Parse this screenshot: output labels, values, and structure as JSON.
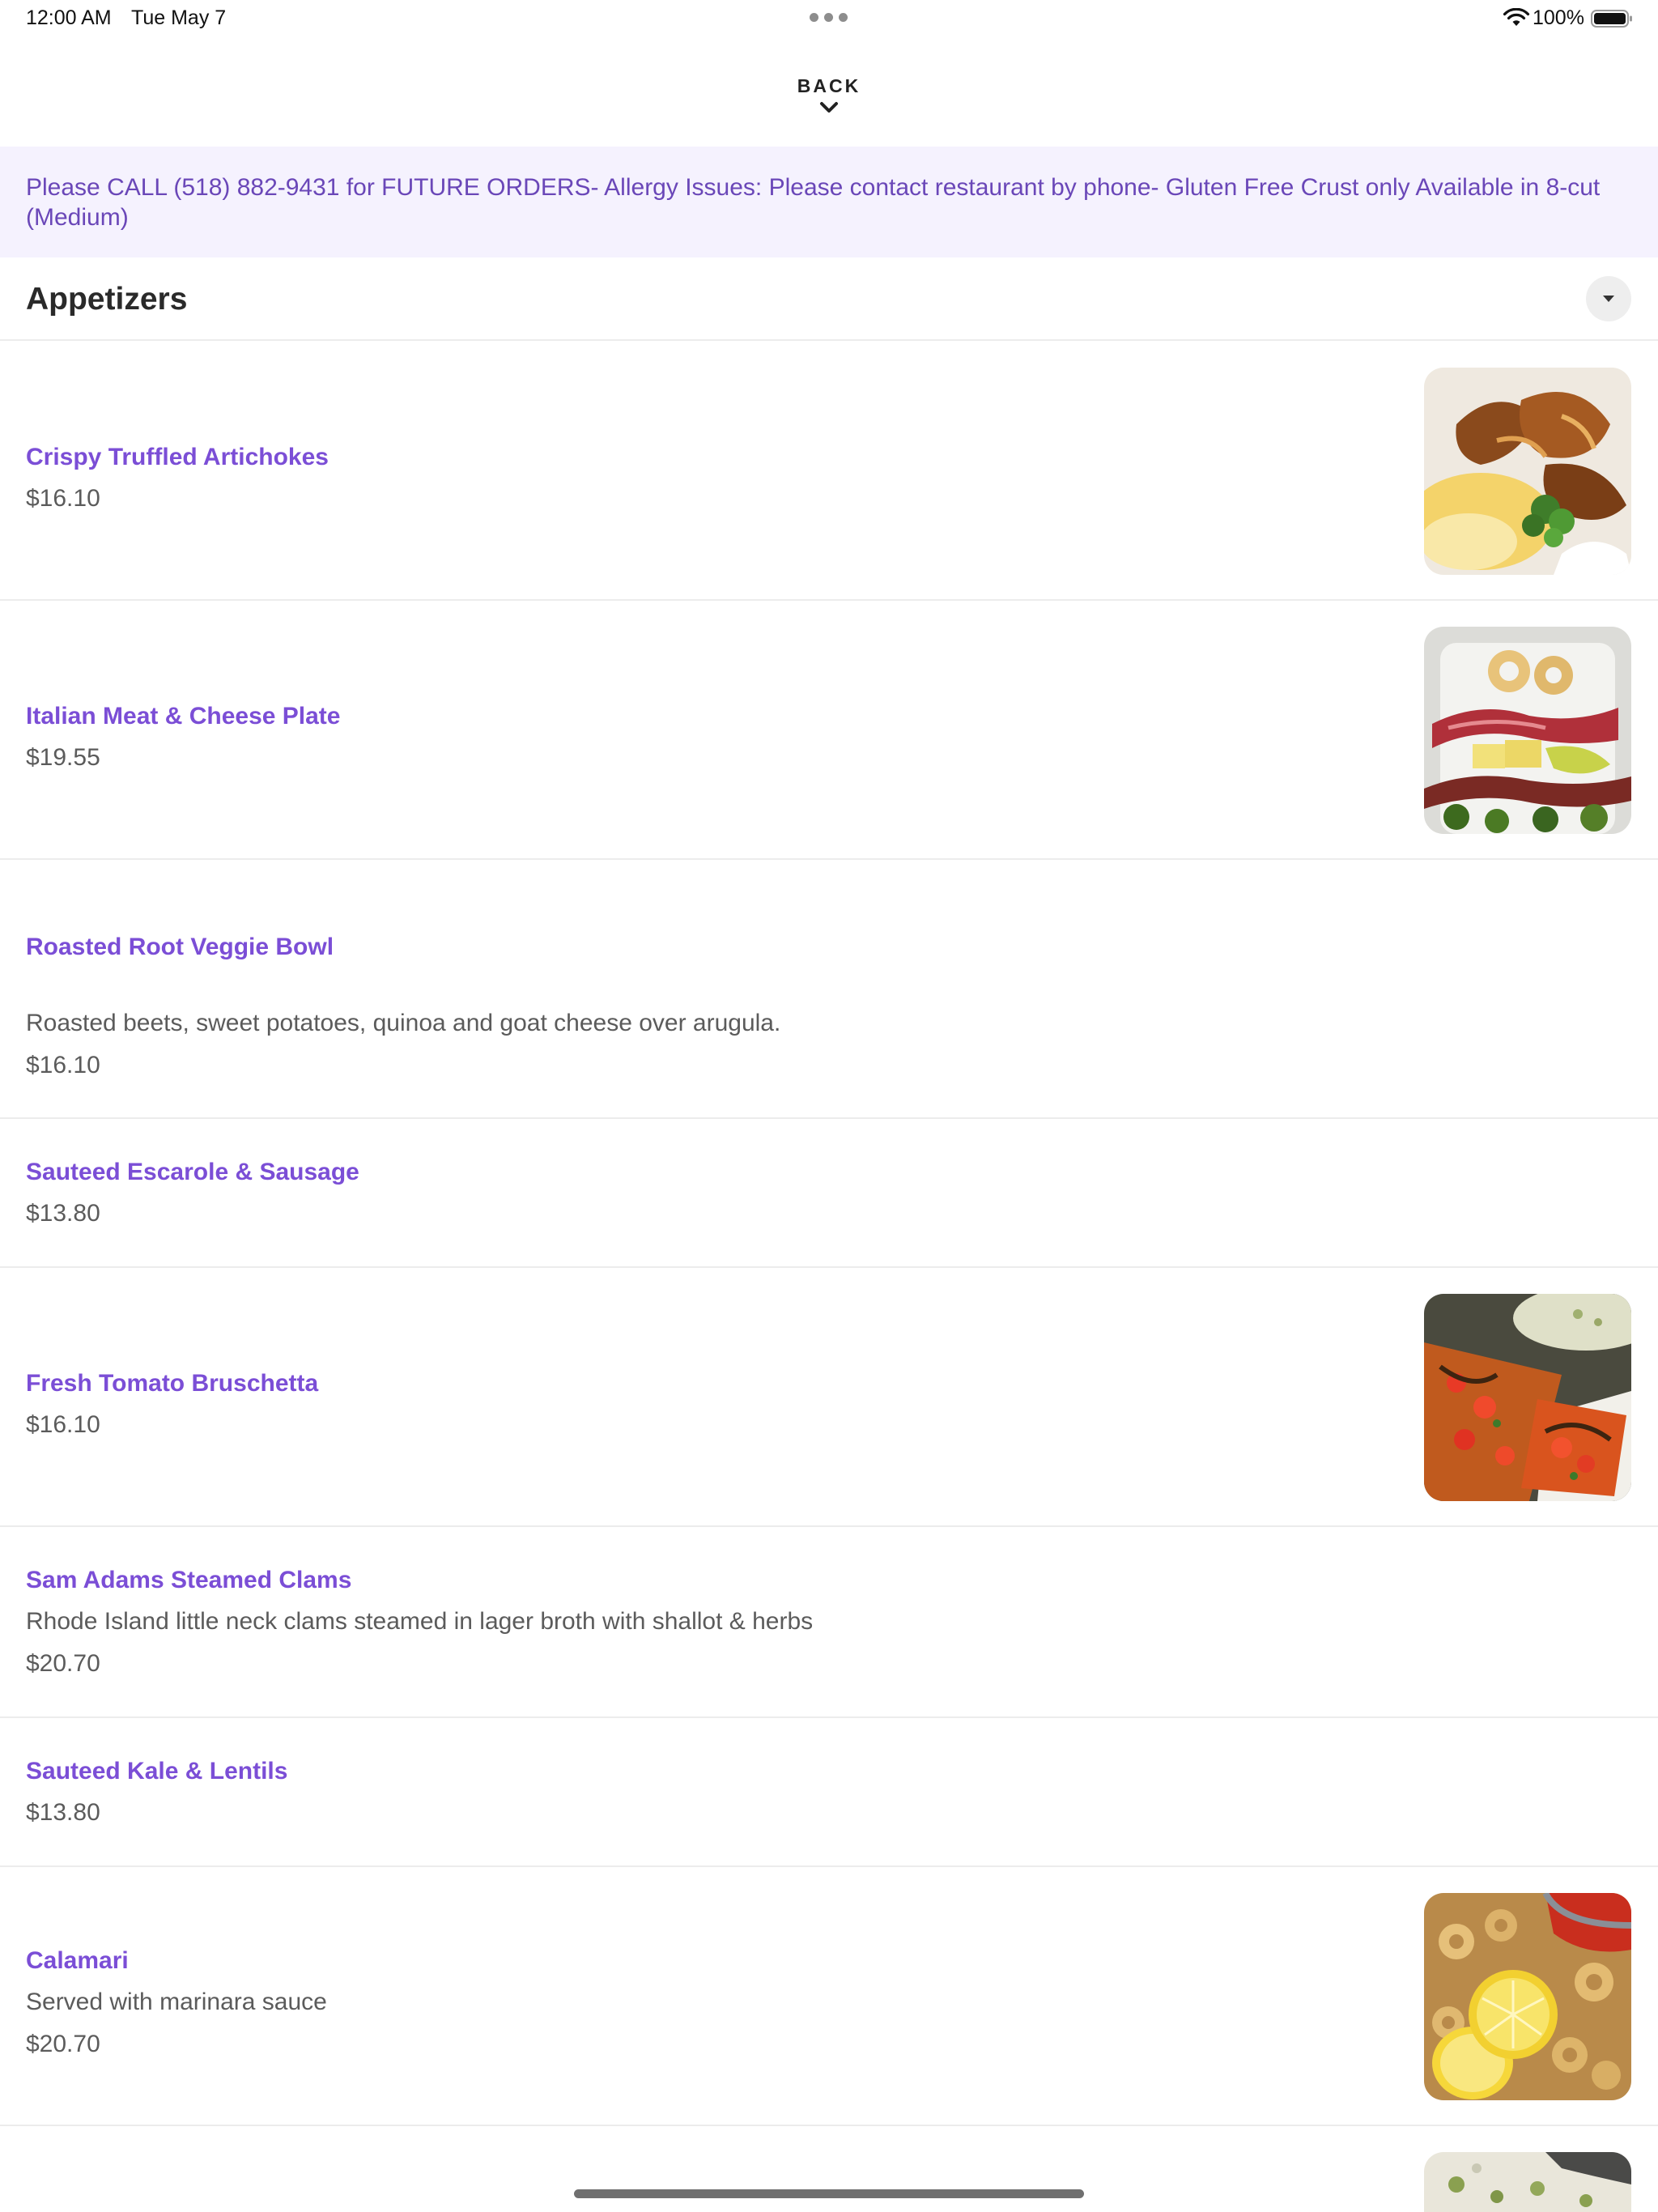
{
  "status_bar": {
    "time": "12:00 AM",
    "date": "Tue May 7",
    "battery_percent": "100%",
    "battery_level": 1.0,
    "wifi_icon": "wifi-icon",
    "battery_icon": "battery-icon",
    "multitasking_icon": "more-dots-icon"
  },
  "header": {
    "back_label": "BACK",
    "back_icon": "chevron-down-icon"
  },
  "notice": {
    "text": "Please CALL (518) 882-9431 for FUTURE ORDERS- Allergy Issues: Please contact restaurant by phone- Gluten Free Crust only Available in 8-cut (Medium)"
  },
  "section": {
    "title": "Appetizers",
    "toggle_icon": "caret-down-icon"
  },
  "items": [
    {
      "name": "Crispy Truffled Artichokes",
      "description": "",
      "price": "$16.10",
      "has_image": true
    },
    {
      "name": "Italian Meat & Cheese Plate",
      "description": "",
      "price": "$19.55",
      "has_image": true
    },
    {
      "name": "Roasted Root Veggie Bowl",
      "description": "Roasted beets, sweet potatoes, quinoa and goat cheese over arugula.",
      "price": "$16.10",
      "has_image": false
    },
    {
      "name": "Sauteed Escarole & Sausage",
      "description": "",
      "price": "$13.80",
      "has_image": false
    },
    {
      "name": "Fresh Tomato Bruschetta",
      "description": "",
      "price": "$16.10",
      "has_image": true
    },
    {
      "name": "Sam Adams Steamed Clams",
      "description": "Rhode Island little neck clams steamed in lager broth with shallot & herbs",
      "price": "$20.70",
      "has_image": false
    },
    {
      "name": "Sauteed Kale & Lentils",
      "description": "",
      "price": "$13.80",
      "has_image": false
    },
    {
      "name": "Calamari",
      "description": "Served with marinara sauce",
      "price": "$20.70",
      "has_image": true
    }
  ],
  "colors": {
    "accent": "#7b4ed6",
    "notice_background": "#f5f2fe",
    "notice_text": "#6a47b8",
    "divider": "#ececec"
  }
}
